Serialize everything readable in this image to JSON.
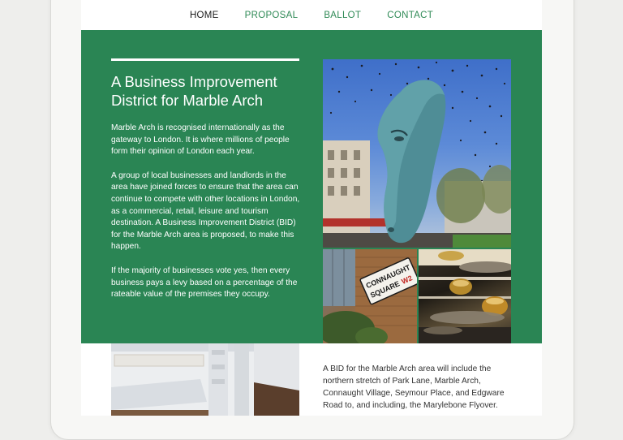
{
  "nav": {
    "items": [
      {
        "label": "HOME",
        "active": true
      },
      {
        "label": "PROPOSAL",
        "active": false
      },
      {
        "label": "BALLOT",
        "active": false
      },
      {
        "label": "CONTACT",
        "active": false
      }
    ]
  },
  "hero": {
    "title_line1": "A Business Improvement",
    "title_line2": "District for Marble Arch",
    "paragraphs": [
      "Marble Arch is recognised internationally as the gateway to London. It is where millions of people form their opinion of London each year.",
      "A group of local businesses and landlords in the area have joined forces to ensure that the area can continue to compete with other locations in London, as a commercial, retail, leisure and tourism destination. A Business Improvement District (BID) for the Marble Arch area is proposed, to make this happen.",
      "If the majority of businesses vote yes, then every business pays a levy based on a percentage of the rateable value of the premises they occupy."
    ]
  },
  "photos": {
    "sign_line1": "CONNAUGHT",
    "sign_line2": "SQUARE",
    "sign_code": "W2"
  },
  "lower": {
    "paragraph": "A BID for the Marble Arch area will include the northern stretch of Park Lane, Marble Arch, Connaught Village, Seymour Place, and Edgware Road to, and including, the Marylebone Flyover."
  },
  "colors": {
    "brand_green": "#2a8554",
    "nav_link": "#2f8a56",
    "nav_active": "#1a1a1a"
  }
}
